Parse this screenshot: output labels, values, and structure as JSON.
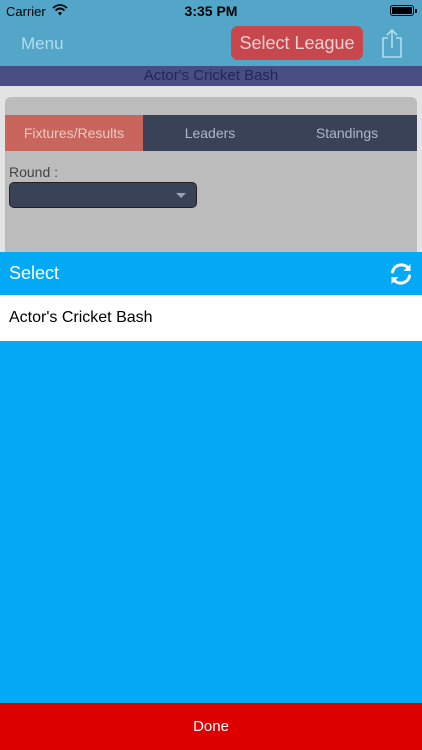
{
  "status_bar": {
    "carrier": "Carrier",
    "time": "3:35 PM"
  },
  "nav": {
    "menu_label": "Menu",
    "select_league_label": "Select League",
    "share_icon": "share-icon"
  },
  "league": {
    "title": "Actor's Cricket Bash"
  },
  "tabs": [
    {
      "label": "Fixtures/Results",
      "active": true
    },
    {
      "label": "Leaders",
      "active": false
    },
    {
      "label": "Standings",
      "active": false
    }
  ],
  "round": {
    "label": "Round :",
    "value": ""
  },
  "picker": {
    "title": "Select",
    "refresh_icon": "refresh-icon",
    "options": [
      "Actor's Cricket Bash"
    ],
    "done_label": "Done"
  },
  "colors": {
    "nav_bg": "#53a6c8",
    "select_league_bg": "#c8474c",
    "tab_active_bg": "#c8665d",
    "tab_bg": "#3a4258",
    "picker_bg": "#03a9f4",
    "done_bg": "#dd0000"
  }
}
